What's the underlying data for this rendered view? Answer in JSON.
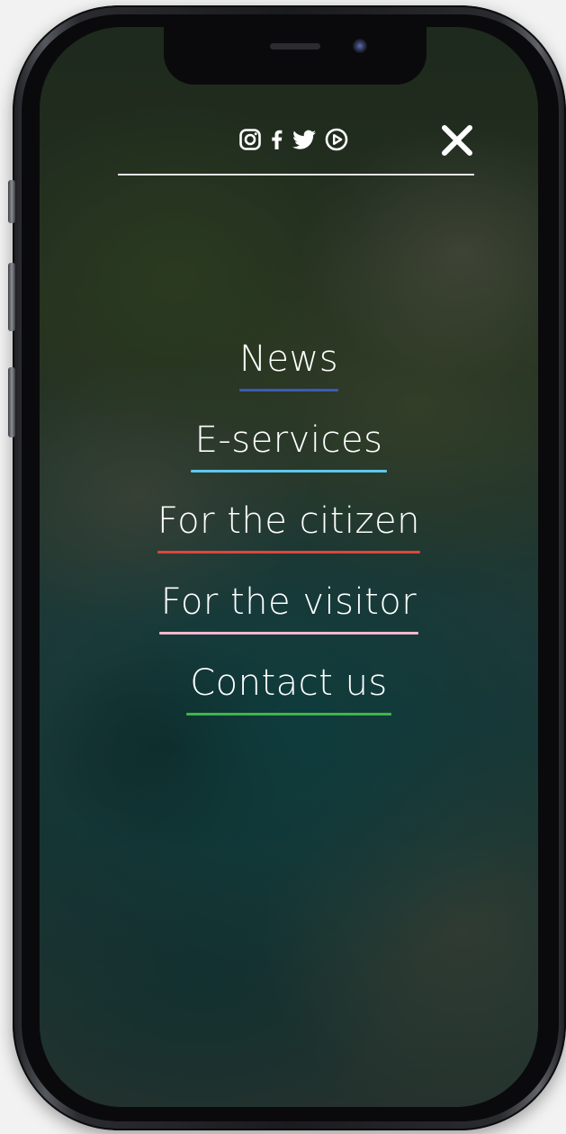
{
  "header": {
    "social": [
      {
        "icon": "instagram-icon"
      },
      {
        "icon": "facebook-icon"
      },
      {
        "icon": "twitter-icon"
      },
      {
        "icon": "youtube-icon"
      }
    ],
    "close_icon": "close-icon"
  },
  "menu": {
    "items": [
      {
        "label": "News",
        "underline_color": "#3d59b8"
      },
      {
        "label": "E-services",
        "underline_color": "#5fc7ea"
      },
      {
        "label": "For the citizen",
        "underline_color": "#e0453b"
      },
      {
        "label": "For the visitor",
        "underline_color": "#f0b9cf"
      },
      {
        "label": "Contact us",
        "underline_color": "#3fb54a"
      }
    ]
  },
  "colors": {
    "text": "#ffffff",
    "rule": "#e6e6e6"
  }
}
